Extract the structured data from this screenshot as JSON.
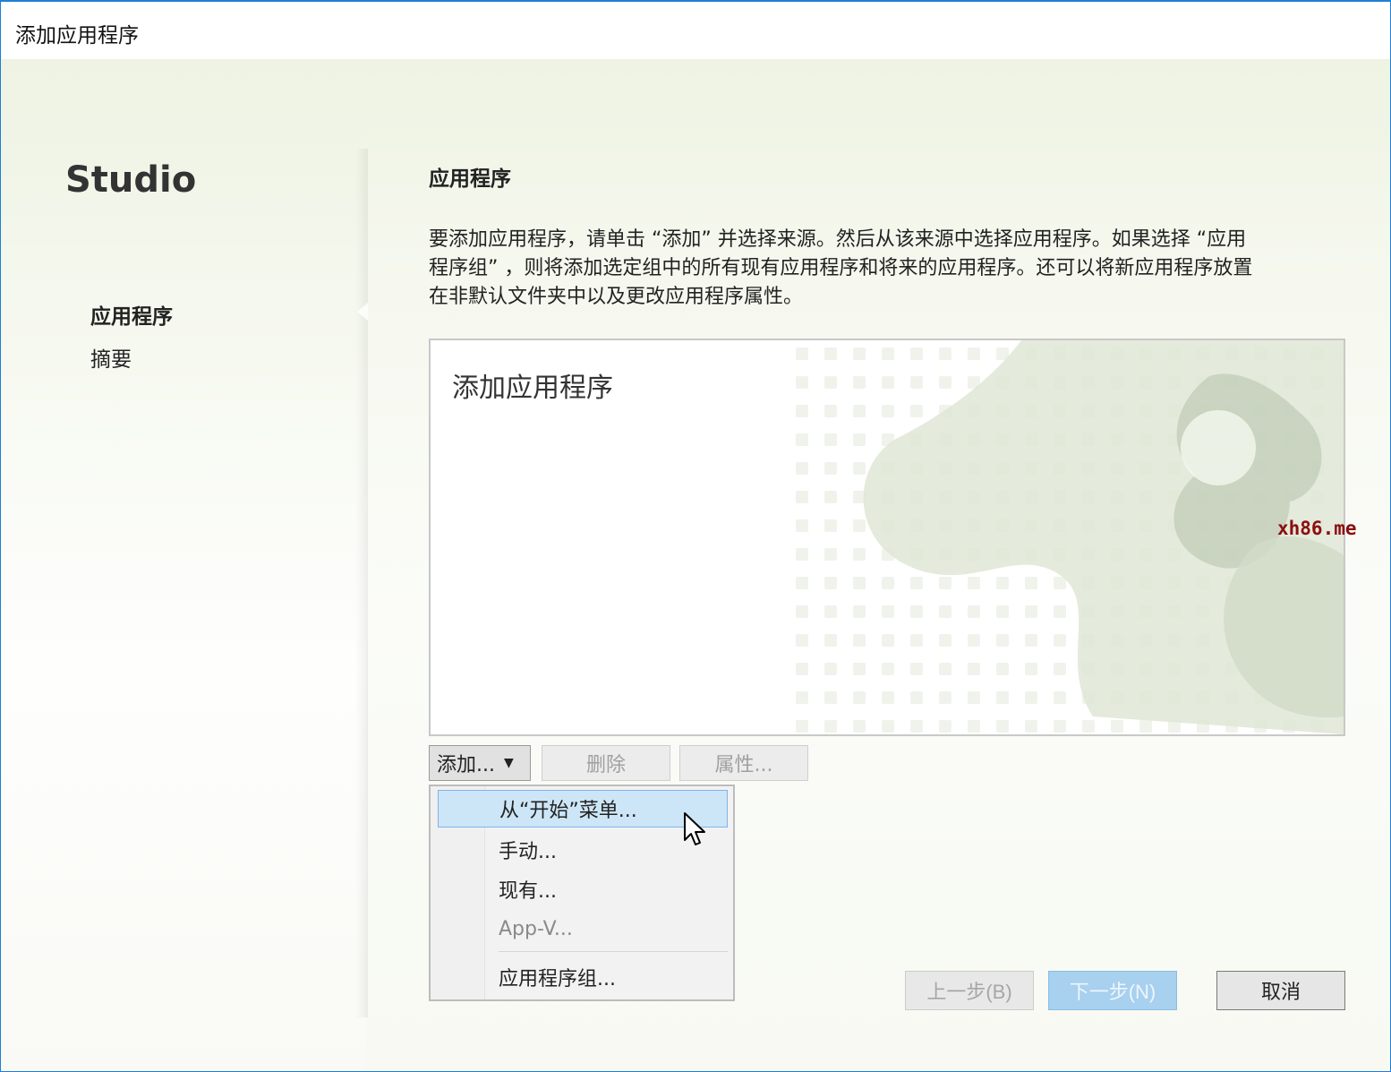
{
  "window": {
    "title": "添加应用程序"
  },
  "left_panel": {
    "product": "Studio",
    "nav": [
      {
        "label": "应用程序",
        "active": true
      },
      {
        "label": "摘要",
        "active": false
      }
    ]
  },
  "main": {
    "section_title": "应用程序",
    "description_lines": [
      "要添加应用程序，请单击 “添加” 并选择来源。然后从该来源中选择应用程序。如果选择 “应用",
      "程序组” ，则将添加选定组中的所有现有应用程序和将来的应用程序。还可以将新应用程序放置",
      "在非默认文件夹中以及更改应用程序属性。"
    ],
    "app_list_label": "添加应用程序",
    "buttons": {
      "add": "添加...",
      "delete": "删除",
      "properties": "属性..."
    },
    "add_menu": [
      {
        "label": "从“开始”菜单...",
        "highlighted": true,
        "disabled": false
      },
      {
        "label": "手动...",
        "highlighted": false,
        "disabled": false
      },
      {
        "label": "现有...",
        "highlighted": false,
        "disabled": false
      },
      {
        "label": "App-V...",
        "highlighted": false,
        "disabled": true
      },
      {
        "label": "应用程序组...",
        "highlighted": false,
        "disabled": false
      }
    ]
  },
  "footer": {
    "back": "上一步(B)",
    "next": "下一步(N)",
    "cancel": "取消"
  },
  "site_watermark": "xh86.me",
  "colors": {
    "window_border": "#1e7fd6",
    "menu_highlight": "#cde6f7",
    "next_button": "#a8d0ef",
    "watermark_text": "#8b0e0e"
  }
}
